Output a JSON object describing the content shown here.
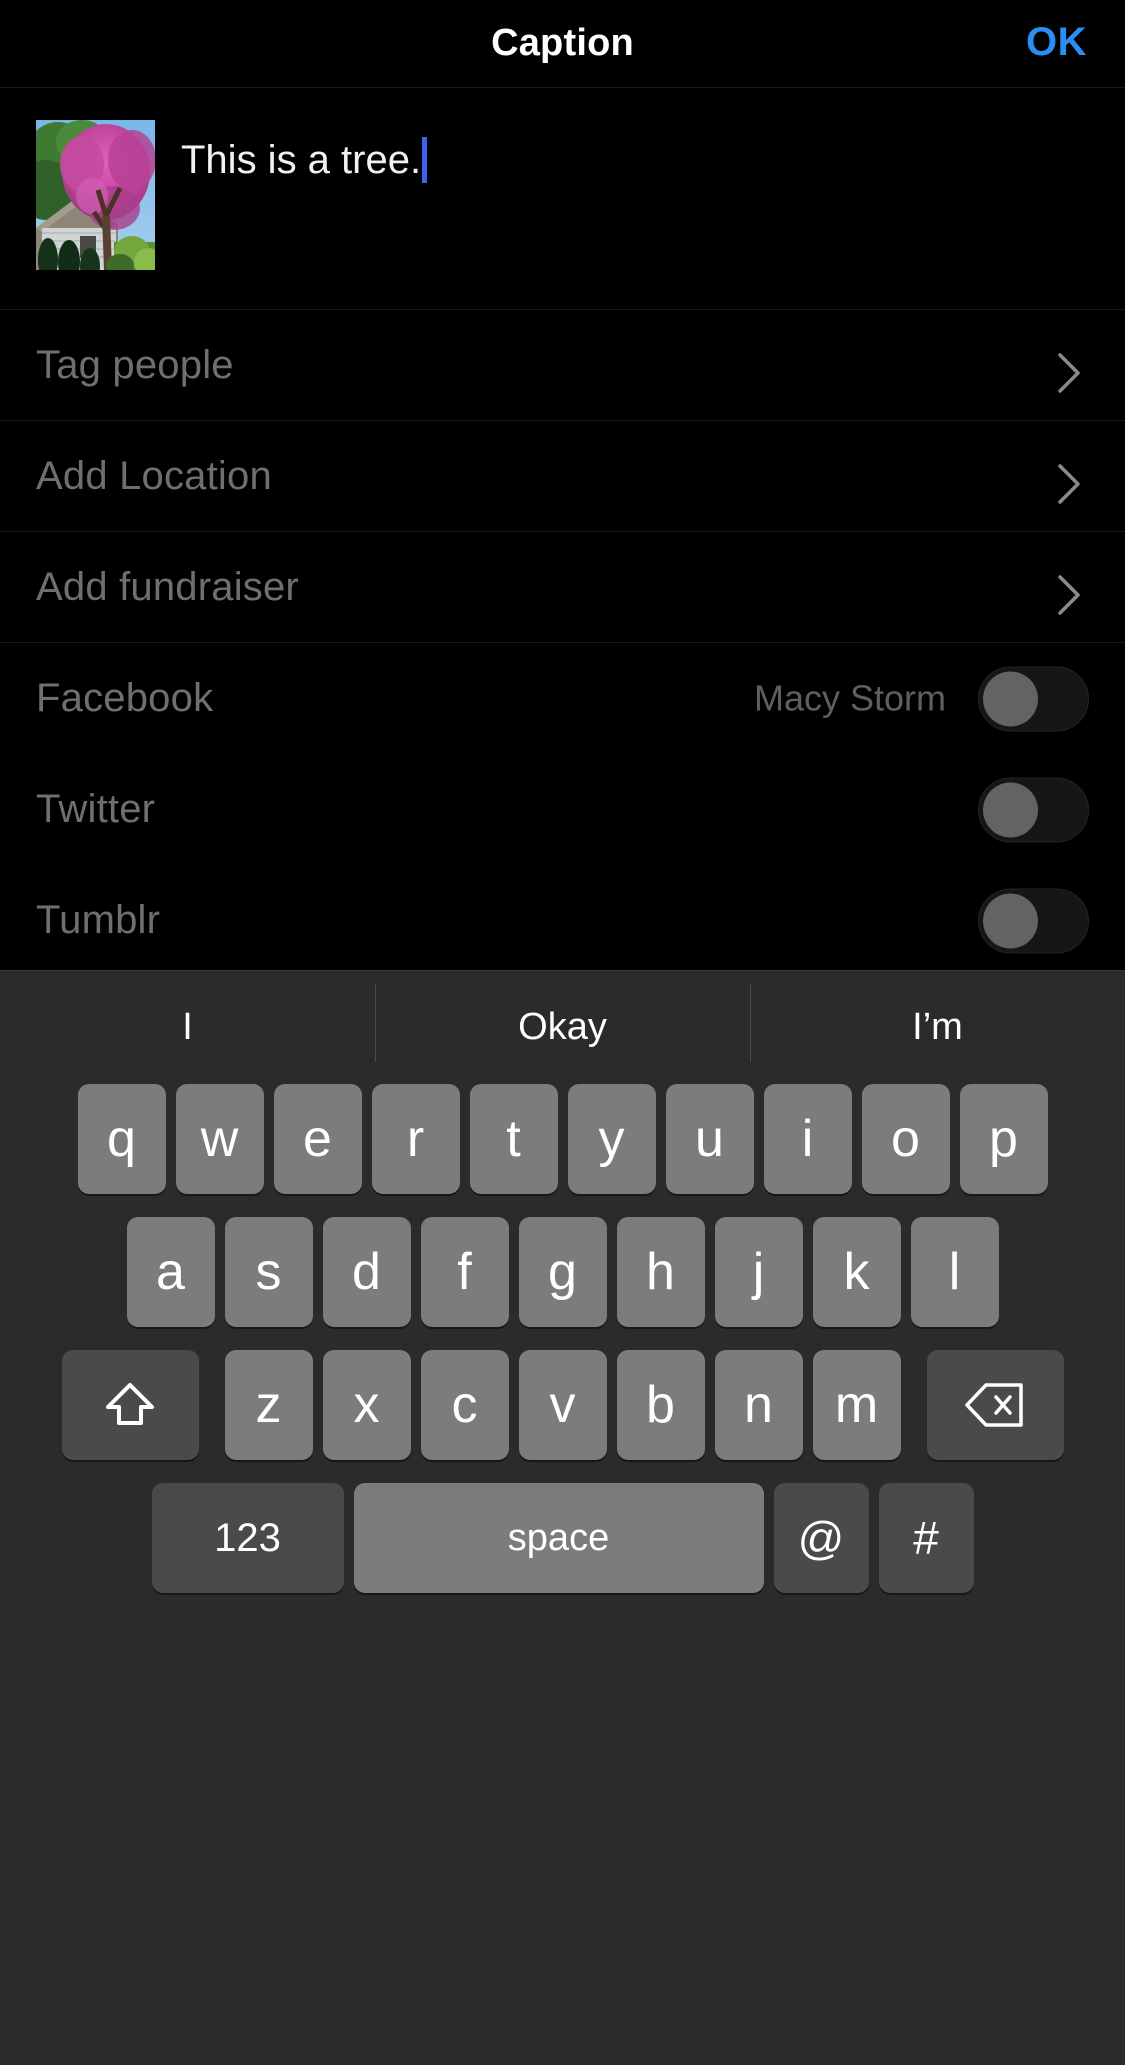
{
  "nav": {
    "title": "Caption",
    "ok_label": "OK"
  },
  "caption": {
    "text": "This is a tree.",
    "thumbnail_alt": "pink flowering redbud tree in front of a house",
    "caret_visible": true
  },
  "options": [
    {
      "label": "Tag people",
      "accessory": "chevron-right-icon"
    },
    {
      "label": "Add Location",
      "accessory": "chevron-right-icon"
    },
    {
      "label": "Add fundraiser",
      "accessory": "chevron-right-icon"
    }
  ],
  "share": [
    {
      "label": "Facebook",
      "account": "Macy Storm",
      "toggle": "off"
    },
    {
      "label": "Twitter",
      "account": "",
      "toggle": "off"
    },
    {
      "label": "Tumblr",
      "account": "",
      "toggle": "off"
    }
  ],
  "keyboard": {
    "suggestions": [
      "I",
      "Okay",
      "I’m"
    ],
    "row1": [
      "q",
      "w",
      "e",
      "r",
      "t",
      "y",
      "u",
      "i",
      "o",
      "p"
    ],
    "row2": [
      "a",
      "s",
      "d",
      "f",
      "g",
      "h",
      "j",
      "k",
      "l"
    ],
    "row3_letters": [
      "z",
      "x",
      "c",
      "v",
      "b",
      "n",
      "m"
    ],
    "shift_icon": "shift-up-arrow-icon",
    "backspace_icon": "backspace-delete-icon",
    "numbers_key": "123",
    "space_key": "space",
    "at_key": "@",
    "hash_key": "#"
  },
  "colors": {
    "background": "#000000",
    "accent_ok": "#2a8ff5",
    "caret": "#3a63f0",
    "label_muted": "#6f6f6f",
    "keyboard_bg": "#2b2b2b",
    "key_bg": "#7c7c7e",
    "key_dark_bg": "#4a4a4c",
    "toggle_knob": "#636366",
    "toggle_track": "#161618",
    "divider": "#1b1b1b"
  }
}
